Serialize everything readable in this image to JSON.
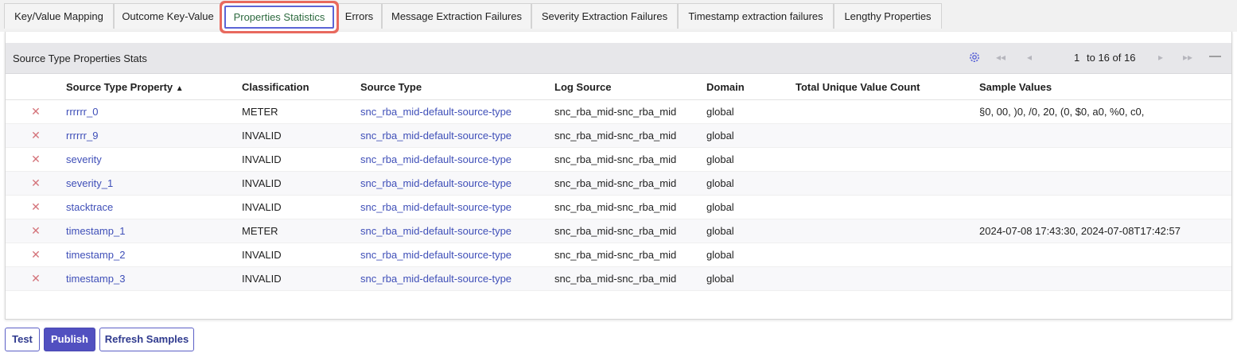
{
  "tabs": [
    {
      "label": "Key/Value Mapping",
      "active": false
    },
    {
      "label": "Outcome Key-Value",
      "active": false
    },
    {
      "label": "Properties Statistics",
      "active": true
    },
    {
      "label": "Errors",
      "active": false
    },
    {
      "label": "Message Extraction Failures",
      "active": false
    },
    {
      "label": "Severity Extraction Failures",
      "active": false
    },
    {
      "label": "Timestamp extraction failures",
      "active": false
    },
    {
      "label": "Lengthy Properties",
      "active": false
    }
  ],
  "panel": {
    "title": "Source Type Properties Stats",
    "pager": {
      "settings_icon": "gear-icon",
      "first_icon": "double-chevron-left-icon",
      "prev_icon": "chevron-left-icon",
      "current_start": "1",
      "to_label": "to 16 of 16",
      "next_icon": "chevron-right-icon",
      "last_icon": "double-chevron-right-icon",
      "collapse_icon": "minus-icon"
    }
  },
  "table": {
    "columns": [
      "",
      "Source Type Property",
      "Classification",
      "Source Type",
      "Log Source",
      "Domain",
      "Total Unique Value Count",
      "Sample Values"
    ],
    "sort_indicator": "▲",
    "rows": [
      {
        "property": "rrrrrr_0",
        "classification": "METER",
        "source_type": "snc_rba_mid-default-source-type",
        "log_source": "snc_rba_mid-snc_rba_mid",
        "domain": "global",
        "count": "",
        "samples": "§0, 00, )0, /0, 20, (0, $0, a0, %0, c0,"
      },
      {
        "property": "rrrrrr_9",
        "classification": "INVALID",
        "source_type": "snc_rba_mid-default-source-type",
        "log_source": "snc_rba_mid-snc_rba_mid",
        "domain": "global",
        "count": "",
        "samples": ""
      },
      {
        "property": "severity",
        "classification": "INVALID",
        "source_type": "snc_rba_mid-default-source-type",
        "log_source": "snc_rba_mid-snc_rba_mid",
        "domain": "global",
        "count": "",
        "samples": ""
      },
      {
        "property": "severity_1",
        "classification": "INVALID",
        "source_type": "snc_rba_mid-default-source-type",
        "log_source": "snc_rba_mid-snc_rba_mid",
        "domain": "global",
        "count": "",
        "samples": ""
      },
      {
        "property": "stacktrace",
        "classification": "INVALID",
        "source_type": "snc_rba_mid-default-source-type",
        "log_source": "snc_rba_mid-snc_rba_mid",
        "domain": "global",
        "count": "",
        "samples": ""
      },
      {
        "property": "timestamp_1",
        "classification": "METER",
        "source_type": "snc_rba_mid-default-source-type",
        "log_source": "snc_rba_mid-snc_rba_mid",
        "domain": "global",
        "count": "",
        "samples": "2024-07-08 17:43:30, 2024-07-08T17:42:57"
      },
      {
        "property": "timestamp_2",
        "classification": "INVALID",
        "source_type": "snc_rba_mid-default-source-type",
        "log_source": "snc_rba_mid-snc_rba_mid",
        "domain": "global",
        "count": "",
        "samples": ""
      },
      {
        "property": "timestamp_3",
        "classification": "INVALID",
        "source_type": "snc_rba_mid-default-source-type",
        "log_source": "snc_rba_mid-snc_rba_mid",
        "domain": "global",
        "count": "",
        "samples": ""
      }
    ],
    "remove_icon": "close-icon",
    "remove_glyph": "✕"
  },
  "buttons": {
    "test": "Test",
    "publish": "Publish",
    "refresh": "Refresh Samples"
  },
  "colors": {
    "active_tab_text": "#2d6a3f",
    "highlight_outline": "#e8695e",
    "link": "#3f4fb8",
    "primary_button": "#5150c0",
    "remove_x": "#d4737a"
  }
}
